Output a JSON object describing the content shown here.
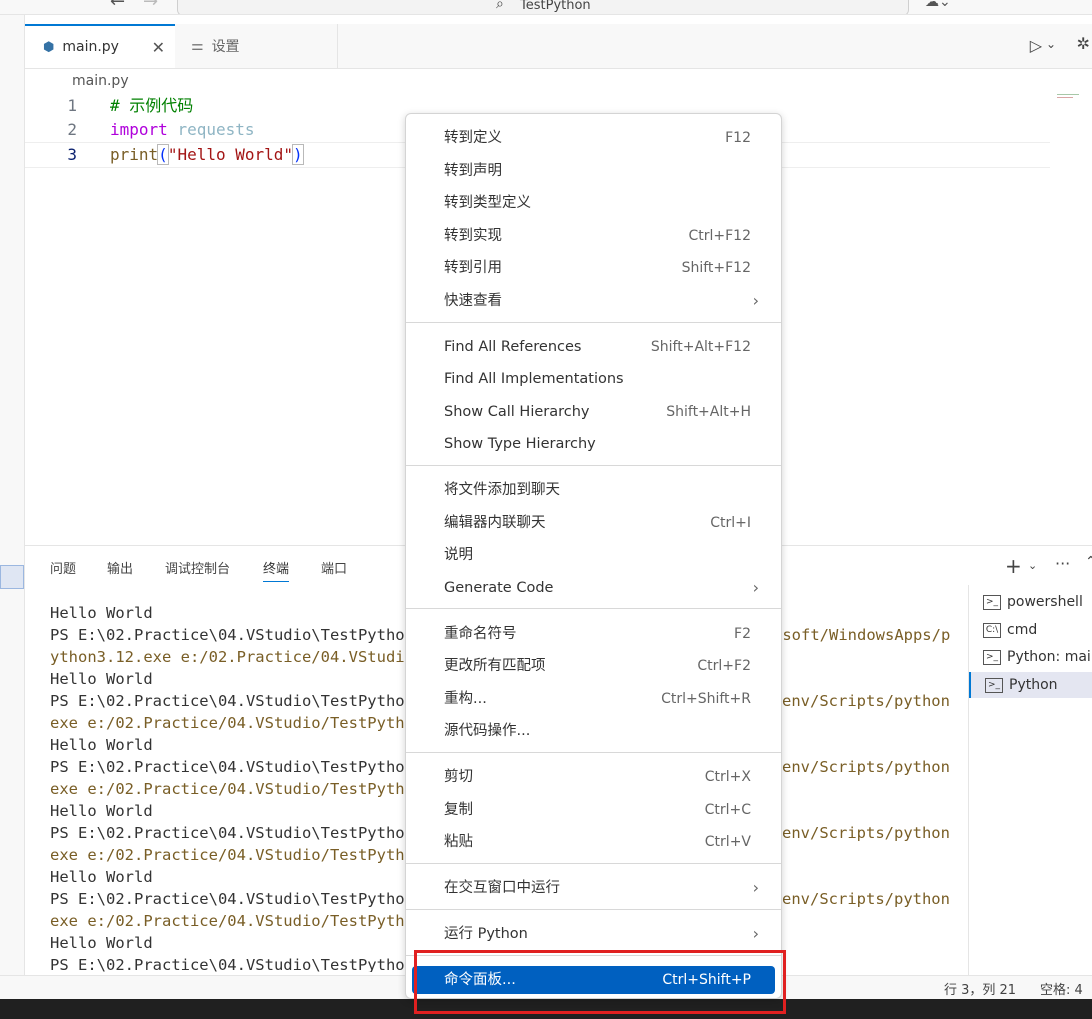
{
  "titlebar": {
    "search_text": "TestPython"
  },
  "tabs": [
    {
      "label": "main.py"
    },
    {
      "label": "设置"
    }
  ],
  "breadcrumb": "main.py",
  "code": {
    "line_numbers": [
      "1",
      "2",
      "3"
    ],
    "line1_comment": "# 示例代码",
    "line2_kw": "import",
    "line2_mod": "requests",
    "line3_fn": "print",
    "line3_open": "(",
    "line3_str": "\"Hello World\"",
    "line3_close": ")"
  },
  "panel": {
    "tabs": [
      "问题",
      "输出",
      "调试控制台",
      "终端",
      "端口"
    ],
    "active_tab": "终端"
  },
  "terminal_lines": [
    "Hello World",
    "PS E:\\02.Practice\\04.VStudio\\TestPython>",
    "ython3.12.exe e:/02.Practice/04.VStudio/",
    "Hello World",
    "PS E:\\02.Practice\\04.VStudio\\TestPython>",
    "exe e:/02.Practice/04.VStudio/TestPython",
    "Hello World",
    "PS E:\\02.Practice\\04.VStudio\\TestPython>",
    "exe e:/02.Practice/04.VStudio/TestPython",
    "Hello World",
    "PS E:\\02.Practice\\04.VStudio\\TestPython>",
    "exe e:/02.Practice/04.VStudio/TestPython",
    "Hello World",
    "PS E:\\02.Practice\\04.VStudio\\TestPython>",
    "exe e:/02.Practice/04.VStudio/TestPython",
    "Hello World",
    "PS E:\\02.Practice\\04.VStudio\\TestPython>"
  ],
  "terminal_right_fragments": [
    "osoft/WindowsApps/p",
    "env/Scripts/python.",
    "env/Scripts/python.",
    "env/Scripts/python.",
    "env/Scripts/python."
  ],
  "terminal_list": [
    {
      "label": "powershell",
      "icon": "terminal-icon"
    },
    {
      "label": "cmd",
      "icon": "cmd-icon"
    },
    {
      "label": "Python: main",
      "icon": "terminal-icon"
    },
    {
      "label": "Python",
      "icon": "terminal-icon"
    }
  ],
  "context_menu": {
    "items": [
      {
        "label": "转到定义",
        "shortcut": "F12"
      },
      {
        "label": "转到声明",
        "shortcut": ""
      },
      {
        "label": "转到类型定义",
        "shortcut": ""
      },
      {
        "label": "转到实现",
        "shortcut": "Ctrl+F12"
      },
      {
        "label": "转到引用",
        "shortcut": "Shift+F12"
      },
      {
        "label": "快速查看",
        "shortcut": ""
      },
      {
        "label": "Find All References",
        "shortcut": "Shift+Alt+F12"
      },
      {
        "label": "Find All Implementations",
        "shortcut": ""
      },
      {
        "label": "Show Call Hierarchy",
        "shortcut": "Shift+Alt+H"
      },
      {
        "label": "Show Type Hierarchy",
        "shortcut": ""
      },
      {
        "label": "将文件添加到聊天",
        "shortcut": ""
      },
      {
        "label": "编辑器内联聊天",
        "shortcut": "Ctrl+I"
      },
      {
        "label": "说明",
        "shortcut": ""
      },
      {
        "label": "Generate Code",
        "shortcut": ""
      },
      {
        "label": "重命名符号",
        "shortcut": "F2"
      },
      {
        "label": "更改所有匹配项",
        "shortcut": "Ctrl+F2"
      },
      {
        "label": "重构...",
        "shortcut": "Ctrl+Shift+R"
      },
      {
        "label": "源代码操作...",
        "shortcut": ""
      },
      {
        "label": "剪切",
        "shortcut": "Ctrl+X"
      },
      {
        "label": "复制",
        "shortcut": "Ctrl+C"
      },
      {
        "label": "粘贴",
        "shortcut": "Ctrl+V"
      },
      {
        "label": "在交互窗口中运行",
        "shortcut": ""
      },
      {
        "label": "运行 Python",
        "shortcut": ""
      },
      {
        "label": "命令面板...",
        "shortcut": "Ctrl+Shift+P"
      }
    ]
  },
  "statusbar": {
    "position": "行 3，列 21",
    "spaces": "空格: 4"
  },
  "colors": {
    "accent": "#0078d4",
    "menu_selected": "#0060c0",
    "annotation_box": "#e02020"
  }
}
